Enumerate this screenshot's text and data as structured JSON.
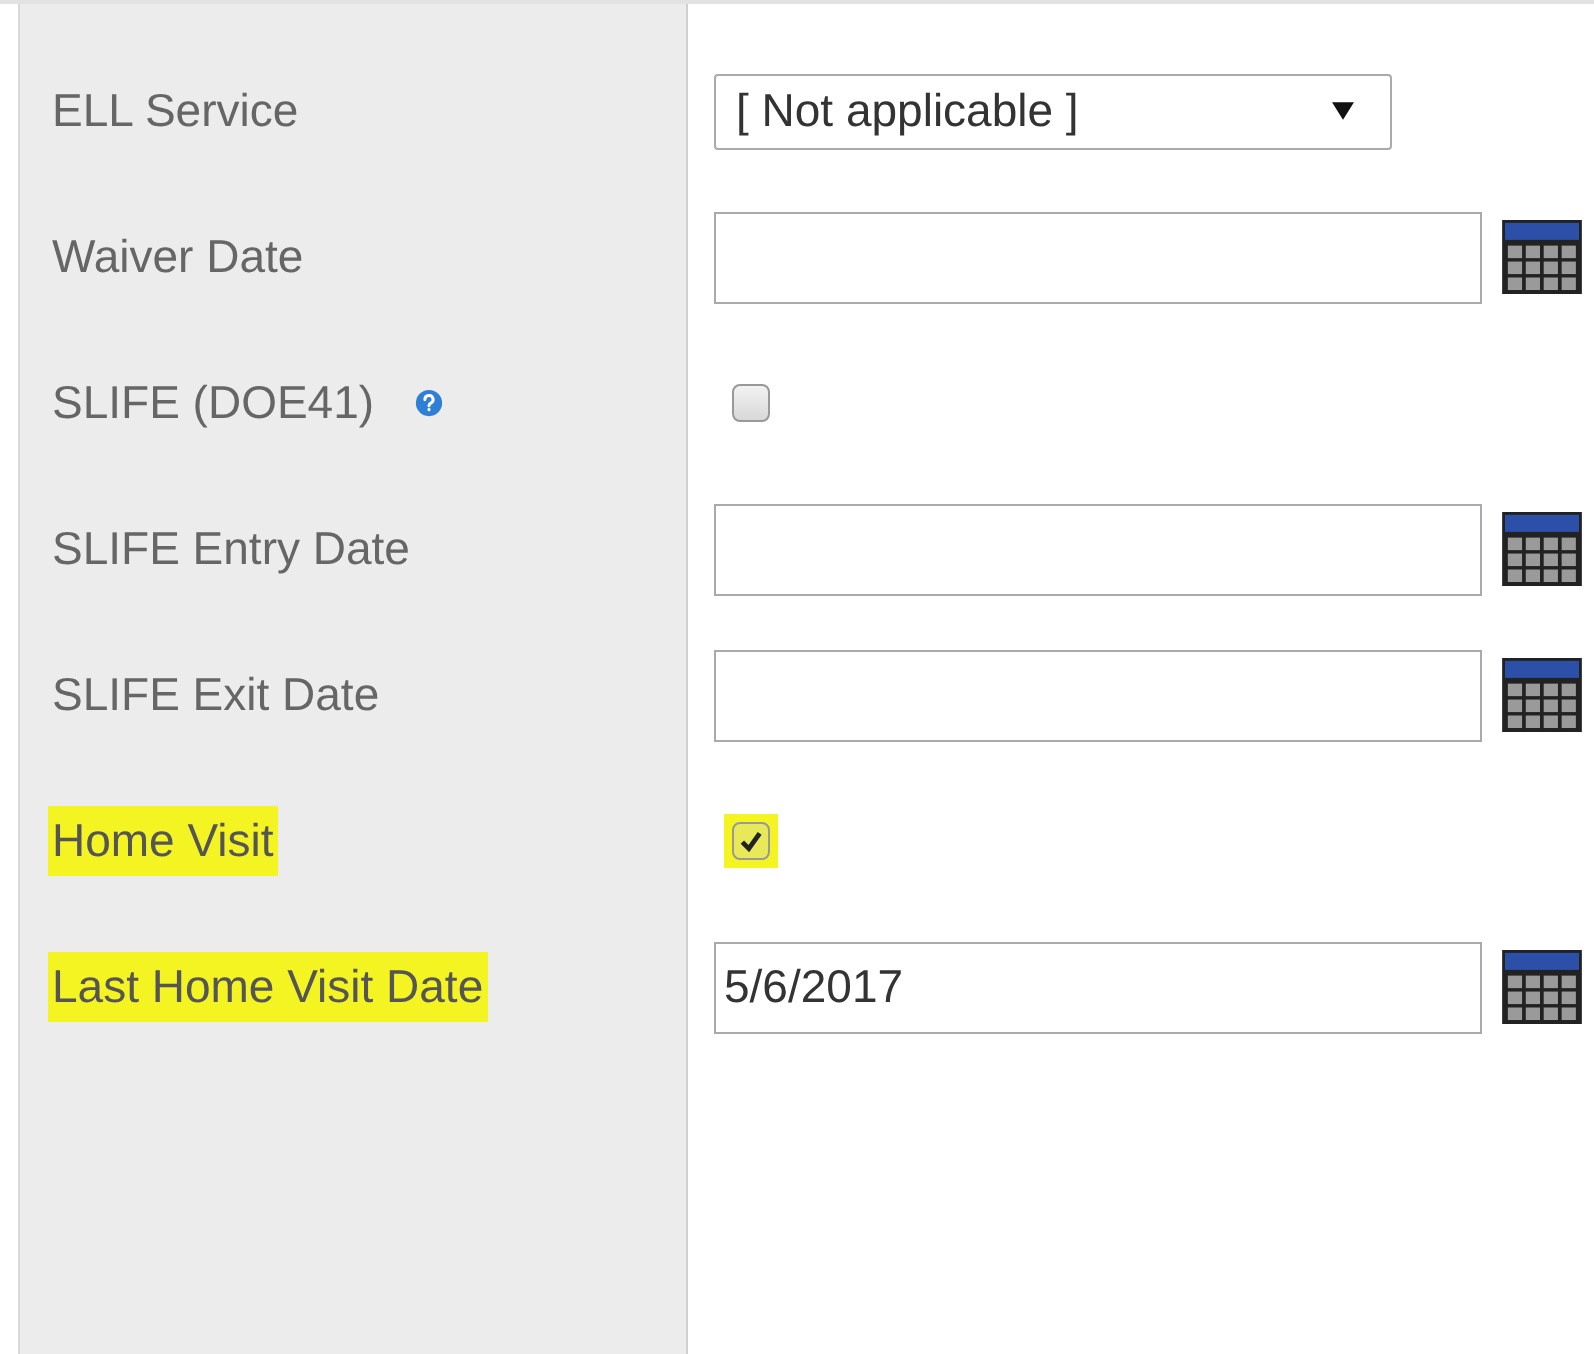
{
  "fields": [
    {
      "label": "ELL Service",
      "kind": "select",
      "value": "[ Not applicable ]",
      "highlighted": false
    },
    {
      "label": "Waiver Date",
      "kind": "date",
      "highlighted": false
    },
    {
      "label": "SLIFE (DOE41)",
      "kind": "checkbox",
      "checked": false,
      "help": true,
      "highlighted": false
    },
    {
      "label": "SLIFE Entry Date",
      "kind": "date",
      "highlighted": false
    },
    {
      "label": "SLIFE Exit Date",
      "kind": "date",
      "highlighted": false
    },
    {
      "label": "Home Visit",
      "kind": "checkbox",
      "checked": true,
      "highlighted": true
    },
    {
      "label": "Last Home Visit Date",
      "kind": "date",
      "value": "5/6/2017",
      "highlighted": true
    }
  ]
}
